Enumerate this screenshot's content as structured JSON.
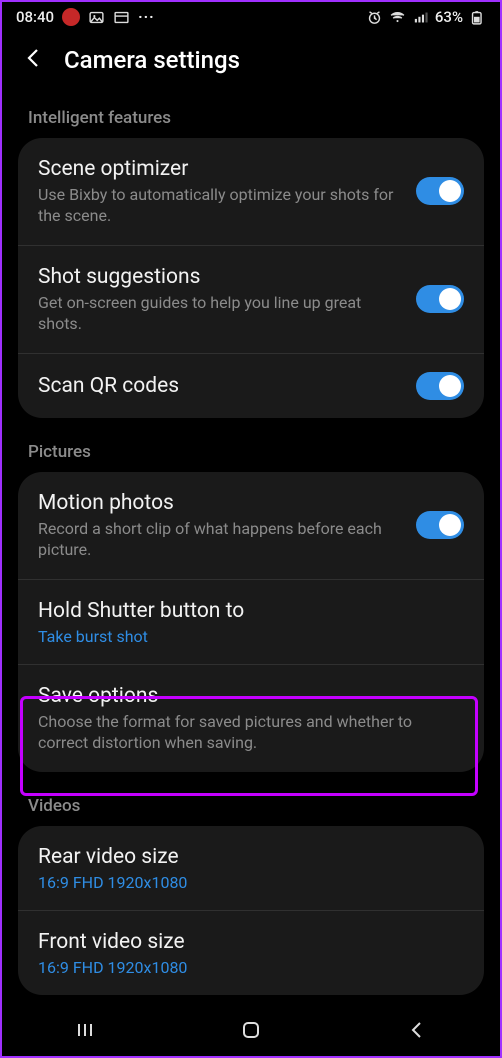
{
  "status": {
    "time": "08:40",
    "battery": "63%"
  },
  "header": {
    "title": "Camera settings"
  },
  "sections": {
    "intelligent": {
      "label": "Intelligent features",
      "scene_optimizer": {
        "title": "Scene optimizer",
        "sub": "Use Bixby to automatically optimize your shots for the scene."
      },
      "shot_suggestions": {
        "title": "Shot suggestions",
        "sub": "Get on-screen guides to help you line up great shots."
      },
      "scan_qr": {
        "title": "Scan QR codes"
      }
    },
    "pictures": {
      "label": "Pictures",
      "motion_photos": {
        "title": "Motion photos",
        "sub": "Record a short clip of what happens before each picture."
      },
      "hold_shutter": {
        "title": "Hold Shutter button to",
        "link": "Take burst shot"
      },
      "save_options": {
        "title": "Save options",
        "sub": "Choose the format for saved pictures and whether to correct distortion when saving."
      }
    },
    "videos": {
      "label": "Videos",
      "rear": {
        "title": "Rear video size",
        "link": "16:9 FHD 1920x1080"
      },
      "front": {
        "title": "Front video size",
        "link": "16:9 FHD 1920x1080"
      }
    }
  }
}
